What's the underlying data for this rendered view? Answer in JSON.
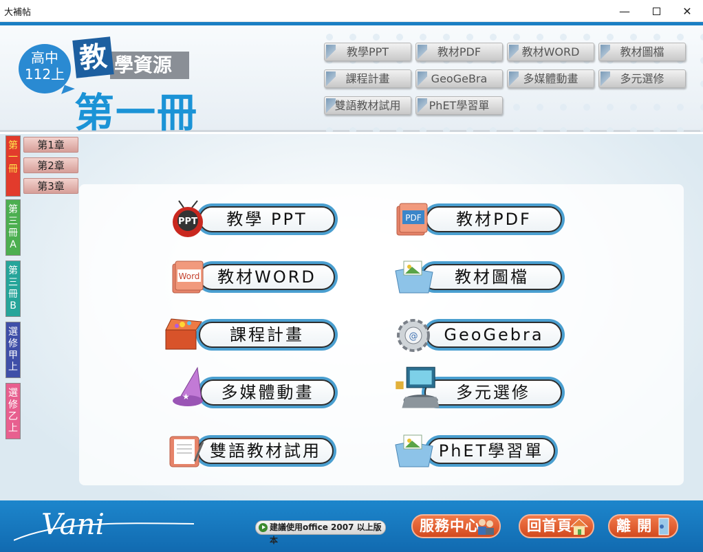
{
  "window": {
    "title": "大補帖",
    "minimize_glyph": "—",
    "close_glyph": "✕"
  },
  "header": {
    "grade_line1": "高中",
    "grade_line2": "112上",
    "title_teach": "教",
    "title_resource": "學資源",
    "volume": "第一冊",
    "links": [
      "教學PPT",
      "教材PDF",
      "教材WORD",
      "教材圖檔",
      "課程計畫",
      "GeoGeBra",
      "多媒體動畫",
      "多元選修",
      "雙語教材試用",
      "PhET學習單"
    ]
  },
  "sidebar": {
    "tabs": [
      {
        "label": [
          "第",
          "一",
          "冊"
        ],
        "color": "#e23b2c",
        "text_color": "#ffe44d"
      },
      {
        "label": [
          "第",
          "三",
          "冊",
          "A"
        ],
        "color": "#4caf50",
        "text_color": "#ffffff"
      },
      {
        "label": [
          "第",
          "三",
          "冊",
          "B"
        ],
        "color": "#26a59a",
        "text_color": "#ffffff"
      },
      {
        "label": [
          "選",
          "修",
          "甲",
          "上"
        ],
        "color": "#3f4fa8",
        "text_color": "#ffffff"
      },
      {
        "label": [
          "選",
          "修",
          "乙",
          "上"
        ],
        "color": "#e85f8f",
        "text_color": "#ffffff"
      }
    ],
    "chapters": [
      "第1章",
      "第2章",
      "第3章"
    ]
  },
  "main": {
    "buttons": [
      {
        "label": "教學 PPT",
        "icon": "ppt-tv-icon"
      },
      {
        "label": "教材PDF",
        "icon": "pdf-book-icon"
      },
      {
        "label": "教材WORD",
        "icon": "word-book-icon"
      },
      {
        "label": "教材圖檔",
        "icon": "image-folder-icon"
      },
      {
        "label": "課程計畫",
        "icon": "treasure-box-icon"
      },
      {
        "label": "GeoGebra",
        "icon": "gear-icon"
      },
      {
        "label": "多媒體動畫",
        "icon": "wizard-hat-icon"
      },
      {
        "label": "多元選修",
        "icon": "monitor-icon"
      },
      {
        "label": "雙語教材試用",
        "icon": "notebook-icon"
      },
      {
        "label": "PhET學習單",
        "icon": "image-folder-icon"
      }
    ]
  },
  "footer": {
    "logo": "Vani",
    "notice": "建議使用office 2007 以上版本",
    "service": "服務中心",
    "home": "回首頁",
    "exit": "離 開"
  },
  "colors": {
    "brand_blue": "#1a7fc4",
    "accent_orange": "#e35a2b",
    "pill_blue": "#4a9fd0"
  }
}
